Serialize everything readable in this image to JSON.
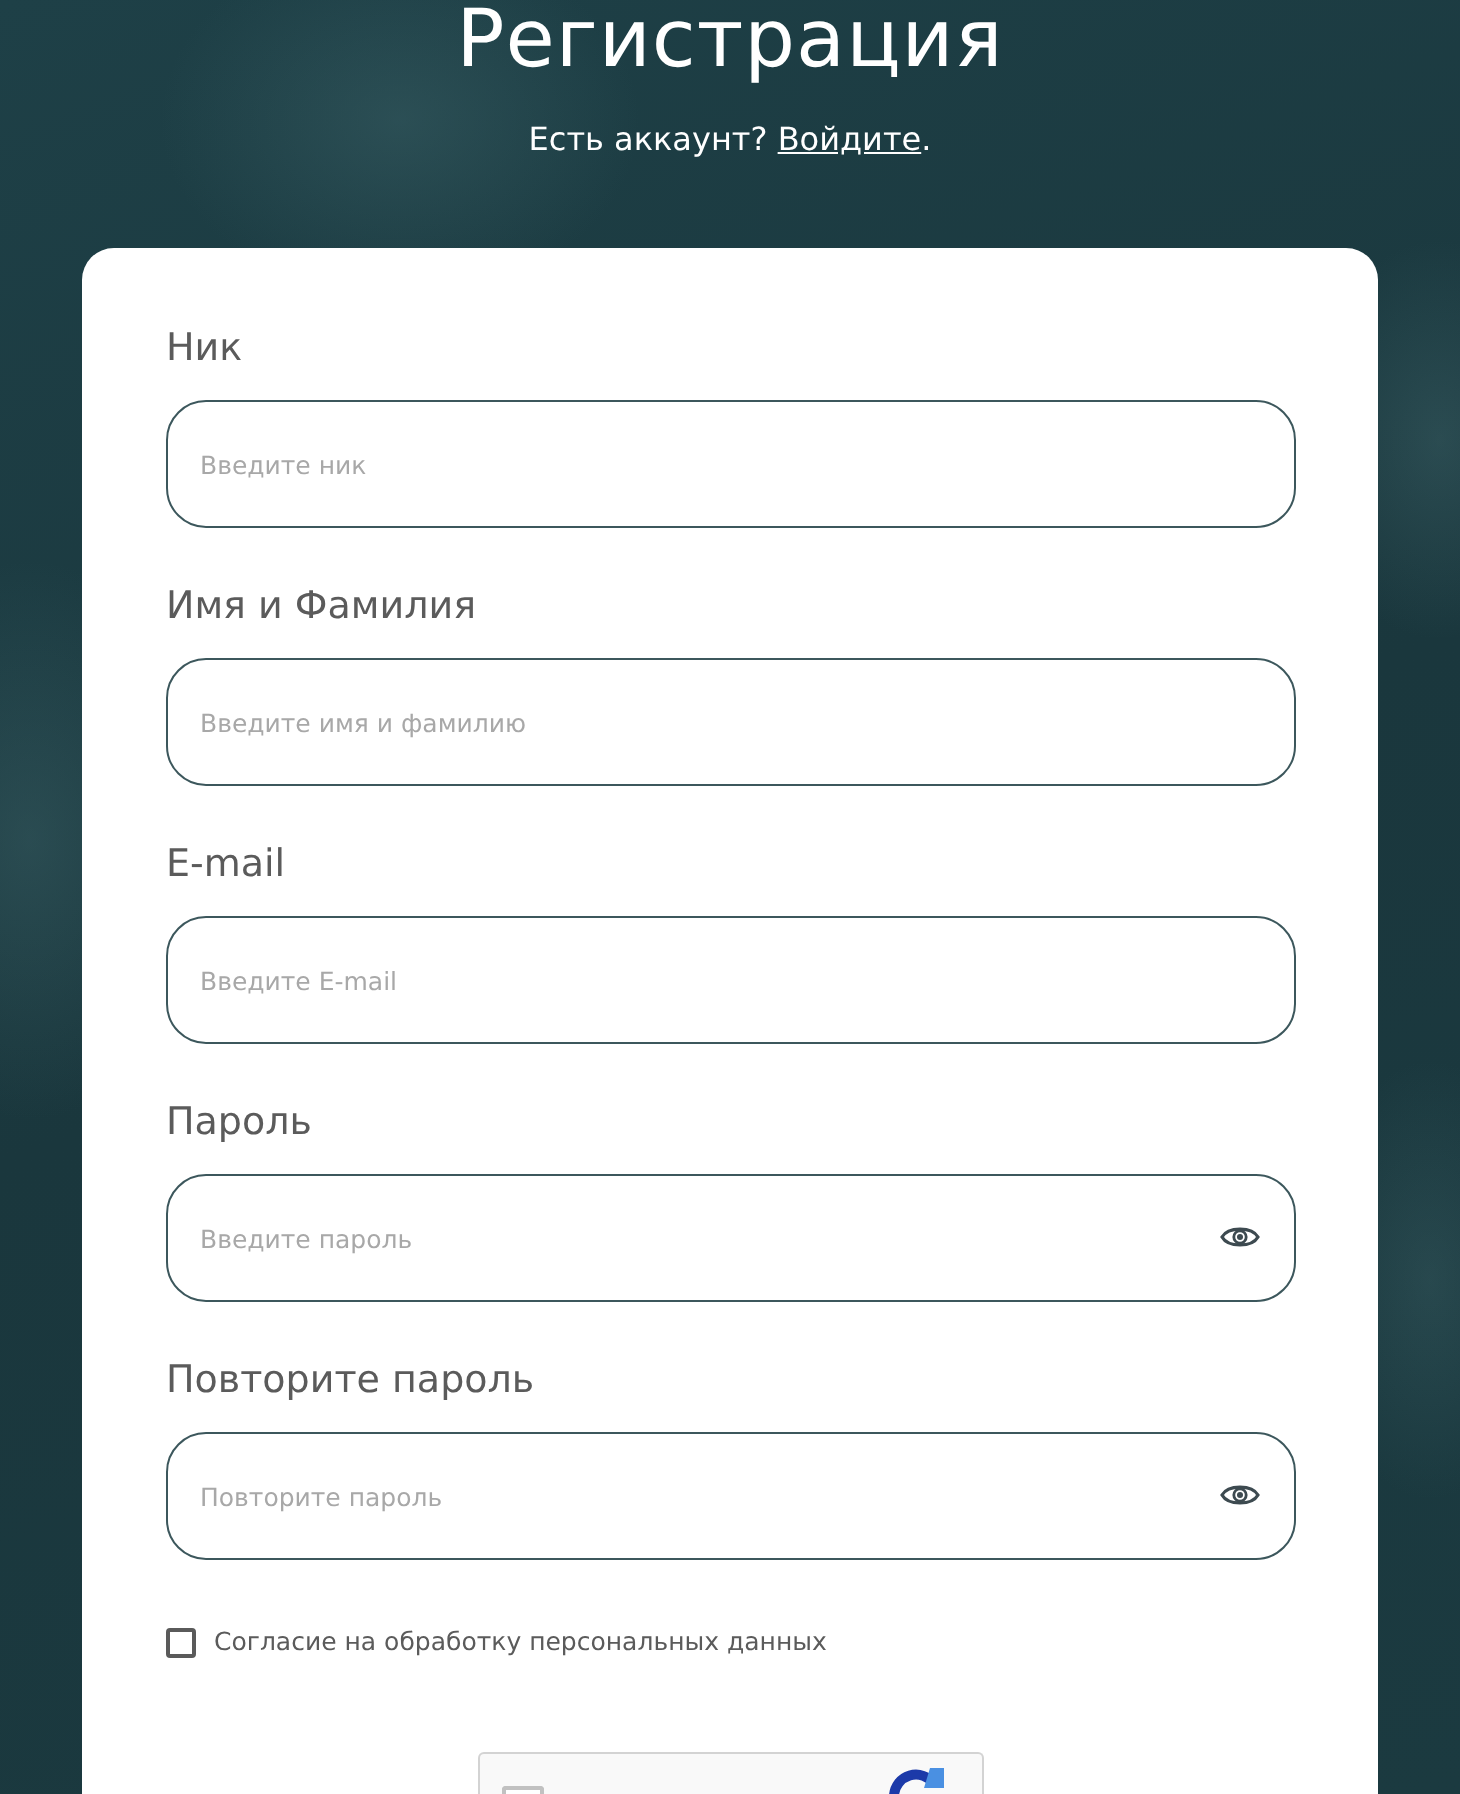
{
  "header": {
    "title": "Регистрация",
    "login_prompt": {
      "text": "Есть аккаунт?",
      "link": "Войдите",
      "after": "."
    }
  },
  "form": {
    "fields": [
      {
        "label": "Ник",
        "placeholder": "Введите ник",
        "kind": "text"
      },
      {
        "label": "Имя и Фамилия",
        "placeholder": "Введите имя и фамилию",
        "kind": "text"
      },
      {
        "label": "E-mail",
        "placeholder": "Введите E-mail",
        "kind": "email"
      },
      {
        "label": "Пароль",
        "placeholder": "Введите пароль",
        "kind": "password"
      },
      {
        "label": "Повторите пароль",
        "placeholder": "Повторите пароль",
        "kind": "password"
      }
    ],
    "consent": {
      "label": "Согласие на обработку персональных данных",
      "checked": false
    },
    "captcha": {
      "checked": false
    }
  }
}
